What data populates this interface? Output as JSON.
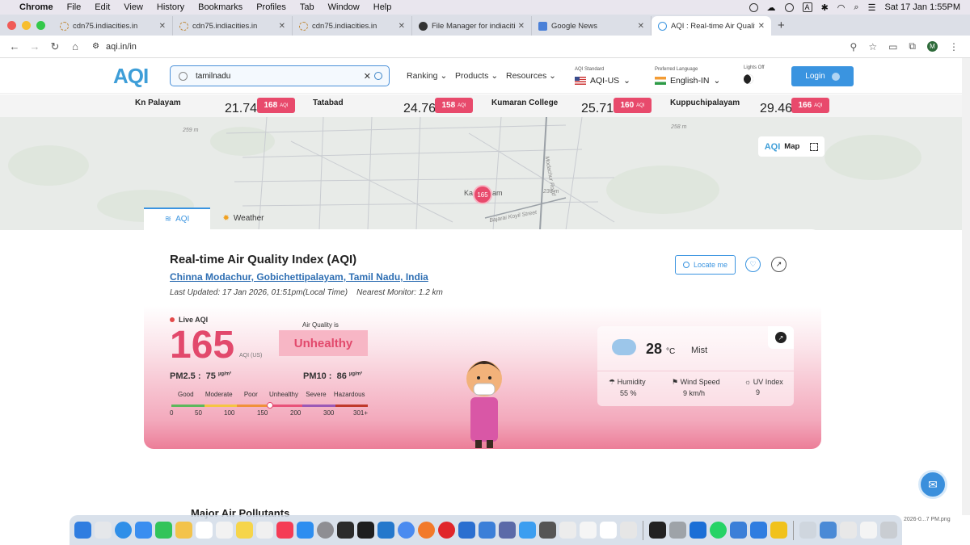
{
  "mac": {
    "menus": [
      "Chrome",
      "File",
      "Edit",
      "View",
      "History",
      "Bookmarks",
      "Profiles",
      "Tab",
      "Window",
      "Help"
    ],
    "datetime": "Sat 17 Jan  1:55PM",
    "a_label": "A"
  },
  "tabs": [
    {
      "title": "cdn75.indiacities.in",
      "color": "#c08a3b"
    },
    {
      "title": "cdn75.indiacities.in",
      "color": "#c08a3b"
    },
    {
      "title": "cdn75.indiacities.in",
      "color": "#c08a3b"
    },
    {
      "title": "File Manager for indiacities.in",
      "color": "#333"
    },
    {
      "title": "Google News",
      "color": "#4a80d8"
    },
    {
      "title": "AQI : Real-time Air Quality Ind",
      "color": "#3a94e0"
    }
  ],
  "address": {
    "url": "aqi.in/in",
    "profile": "M"
  },
  "site": {
    "logo": "AQI",
    "search_value": "tamilnadu",
    "nav": [
      "Ranking",
      "Products",
      "Resources"
    ],
    "aqi_standard_label": "AQI Standard",
    "aqi_standard": "AQI-US",
    "language_label": "Preferred Language",
    "language": "English-IN",
    "lights_label": "Lights Off",
    "login": "Login"
  },
  "nearby": [
    {
      "name": "Kn Palayam",
      "dist": "21.74 km",
      "aqi": "168"
    },
    {
      "name": "Tatabad",
      "dist": "24.76 km",
      "aqi": "158"
    },
    {
      "name": "Kumaran College",
      "dist": "25.71 km",
      "aqi": "160"
    },
    {
      "name": "Kuppuchipalayam",
      "dist": "29.46 km",
      "aqi": "166"
    }
  ],
  "aqi_unit_small": "AQI",
  "map": {
    "labels": [
      "259 m",
      "258 m",
      "236 m",
      "Modachur Road",
      "Bajarai Koyil Street",
      "Ka",
      "am"
    ],
    "marker": "165",
    "btn": "Map"
  },
  "main_tabs": [
    "AQI",
    "Weather"
  ],
  "card": {
    "title": "Real-time Air Quality Index (AQI)",
    "location": "Chinna Modachur, Gobichettipalayam, Tamil Nadu, India",
    "updated": "Last Updated: 17 Jan 2026, 01:51pm(Local Time)",
    "monitor": "Nearest Monitor: 1.2 km",
    "locate": "Locate me",
    "live": "Live AQI",
    "aqi": "165",
    "unit": "AQI (US)",
    "aq_label": "Air Quality is",
    "status": "Unhealthy",
    "pm25_label": "PM2.5 :",
    "pm25": "75",
    "pm10_label": "PM10 :",
    "pm10": "86",
    "pm_unit": "µg/m³",
    "scale_labels": [
      "Good",
      "Moderate",
      "Poor",
      "Unhealthy",
      "Severe",
      "Hazardous"
    ],
    "scale_nums": [
      "0",
      "50",
      "100",
      "150",
      "200",
      "300",
      "301+"
    ],
    "scale_colors": [
      "#5cb85c",
      "#f5c542",
      "#f0913a",
      "#e8537a",
      "#9b59b6",
      "#c0392b"
    ],
    "aqi_fraction": 0.5
  },
  "weather": {
    "temp": "28",
    "unit": "°C",
    "cond": "Mist",
    "humidity_label": "Humidity",
    "humidity": "55 %",
    "wind_label": "Wind Speed",
    "wind": "9 km/h",
    "uv_label": "UV Index",
    "uv": "9"
  },
  "below_heading": "Major Air Pollutants",
  "screenshot_label": "2026-0...7 PM.png"
}
